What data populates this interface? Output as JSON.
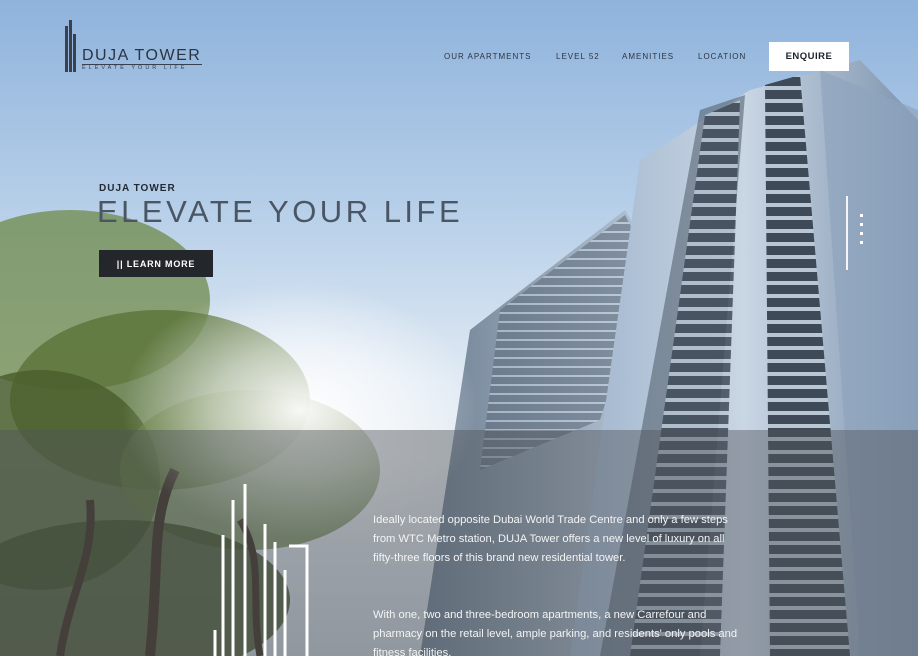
{
  "brand": {
    "name": "DUJA TOWER",
    "tagline": "ELEVATE YOUR LIFE"
  },
  "nav": {
    "items": [
      {
        "label": "OUR APARTMENTS"
      },
      {
        "label": "LEVEL 52"
      },
      {
        "label": "AMENITIES"
      },
      {
        "label": "LOCATION"
      }
    ],
    "cta_label": "ENQUIRE"
  },
  "hero": {
    "eyebrow": "DUJA TOWER",
    "headline": "ELEVATE YOUR LIFE",
    "button_label": "|| LEARN MORE",
    "slide_count": 4
  },
  "description": {
    "paragraph_1": "Ideally located opposite Dubai World Trade Centre and only a few steps from WTC Metro station, DUJA Tower offers a new level of luxury on all fifty-three floors of this brand new residential tower.",
    "paragraph_2": "With one, two and three-bedroom apartments, a new Carrefour and pharmacy on the retail level, ample parking, and residents' only pools and fitness facilities."
  },
  "colors": {
    "sky_top": "#8fb3dc",
    "headline": "#4a5664",
    "button_dark": "#23262b",
    "band_overlay": "rgba(80,84,90,0.45)"
  }
}
